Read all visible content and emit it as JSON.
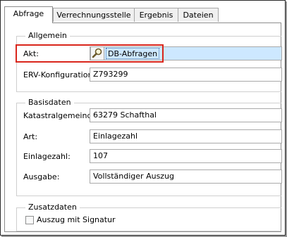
{
  "tabs": [
    {
      "label": "Abfrage",
      "active": true
    },
    {
      "label": "Verrechnungsstelle",
      "active": false
    },
    {
      "label": "Ergebnis",
      "active": false
    },
    {
      "label": "Dateien",
      "active": false
    }
  ],
  "allgemein": {
    "title": "Allgemein",
    "akt_label": "Akt:",
    "akt_value": "DB-Abfragen",
    "akt_icon": "magnifier-icon",
    "erv_label": "ERV-Konfiguration:",
    "erv_value": "Z793299"
  },
  "basisdaten": {
    "title": "Basisdaten",
    "kg_label": "Katastralgemeinde:",
    "kg_value": "63279 Schafthal",
    "art_label": "Art:",
    "art_value": "Einlagezahl",
    "ez_label": "Einlagezahl:",
    "ez_value": "107",
    "ausgabe_label": "Ausgabe:",
    "ausgabe_value": "Vollständiger Auszug"
  },
  "zusatzdaten": {
    "title": "Zusatzdaten",
    "signatur_label": "Auszug mit Signatur",
    "signatur_checked": false
  },
  "colors": {
    "highlight": "#d9261c",
    "selection": "#cde8ff"
  }
}
